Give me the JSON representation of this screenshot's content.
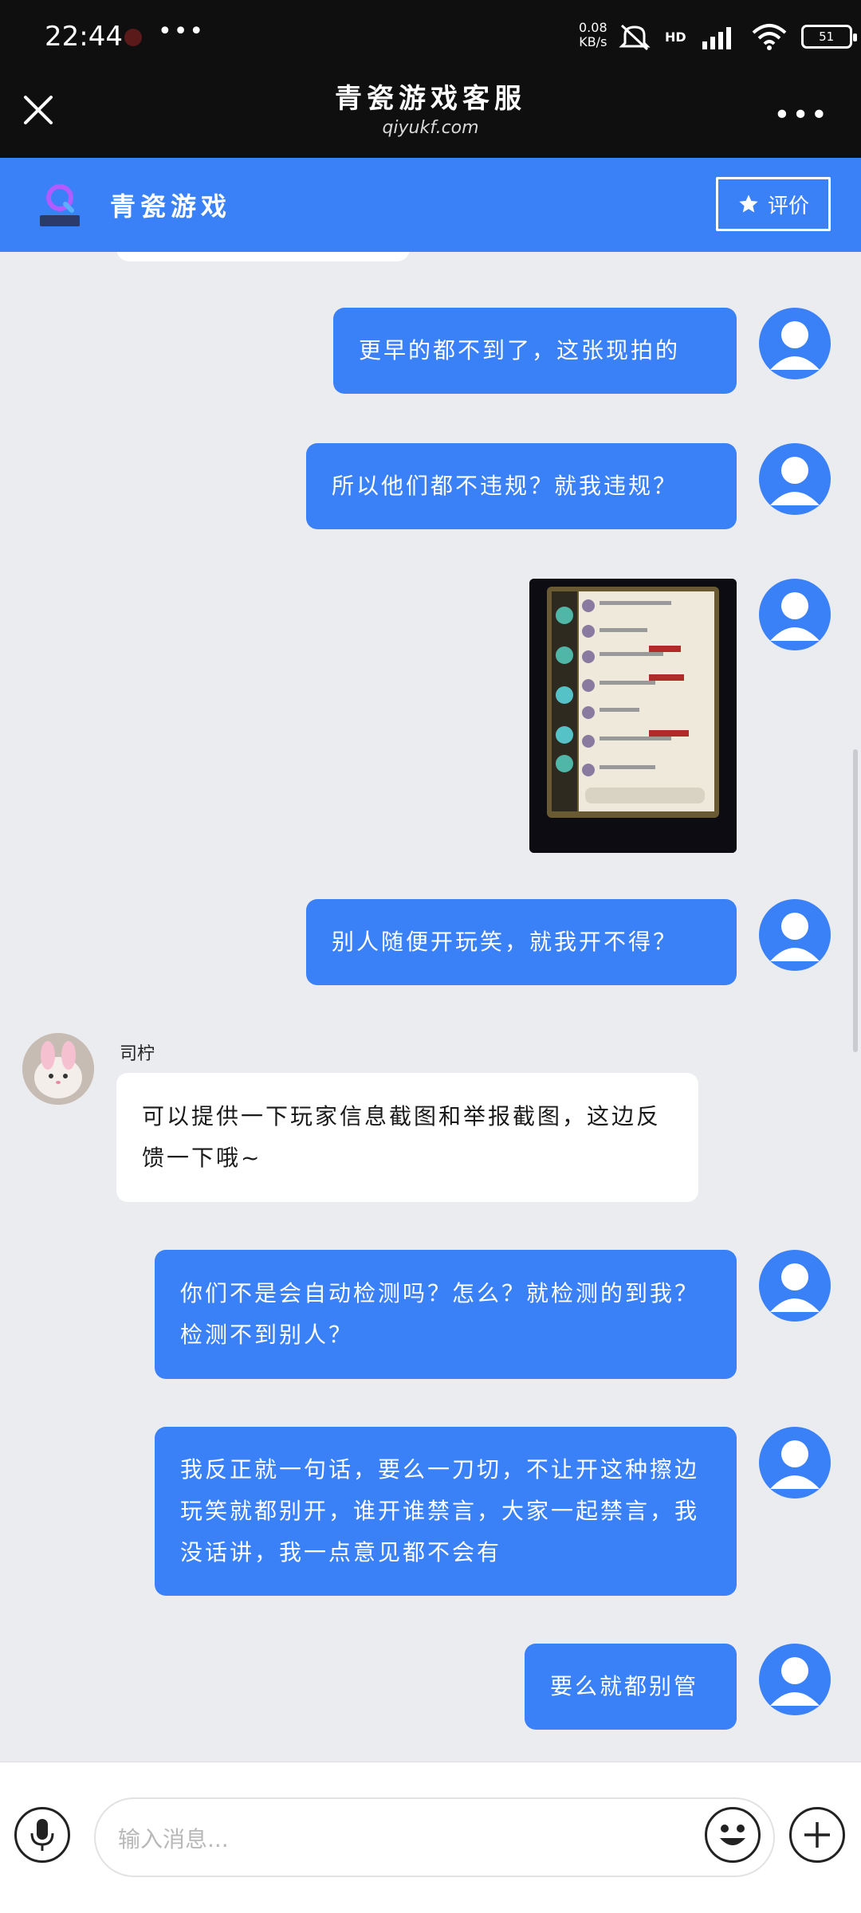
{
  "status_bar": {
    "time": "22:44",
    "more": "•••",
    "net_speed_value": "0.08",
    "net_speed_unit": "KB/s",
    "hd": "HD",
    "battery": "51"
  },
  "title_bar": {
    "title": "青瓷游戏客服",
    "subtitle": "qiyukf.com",
    "more": "•••"
  },
  "header": {
    "title": "青瓷游戏",
    "rate_label": "评价",
    "logo_text": "青瓷游戏"
  },
  "chat": {
    "agent_name": "司柠",
    "messages": [
      {
        "side": "right",
        "text": "更早的都不到了，这张现拍的"
      },
      {
        "side": "right",
        "text": "所以他们都不违规？就我违规？"
      },
      {
        "side": "right",
        "type": "image"
      },
      {
        "side": "right",
        "text": "别人随便开玩笑，就我开不得？"
      },
      {
        "side": "left",
        "text": "可以提供一下玩家信息截图和举报截图，这边反馈一下哦~"
      },
      {
        "side": "right",
        "text": "你们不是会自动检测吗？怎么？就检测的到我？检测不到别人？"
      },
      {
        "side": "right",
        "text": "我反正就一句话，要么一刀切，不让开这种擦边玩笑就都别开，谁开谁禁言，大家一起禁言，我没话讲，我一点意见都不会有"
      },
      {
        "side": "right",
        "text": "要么就都别管"
      }
    ]
  },
  "input": {
    "placeholder": "输入消息..."
  },
  "colors": {
    "accent": "#3a80f6",
    "background": "#ebecf0",
    "status_bar": "#0f0f0f"
  }
}
